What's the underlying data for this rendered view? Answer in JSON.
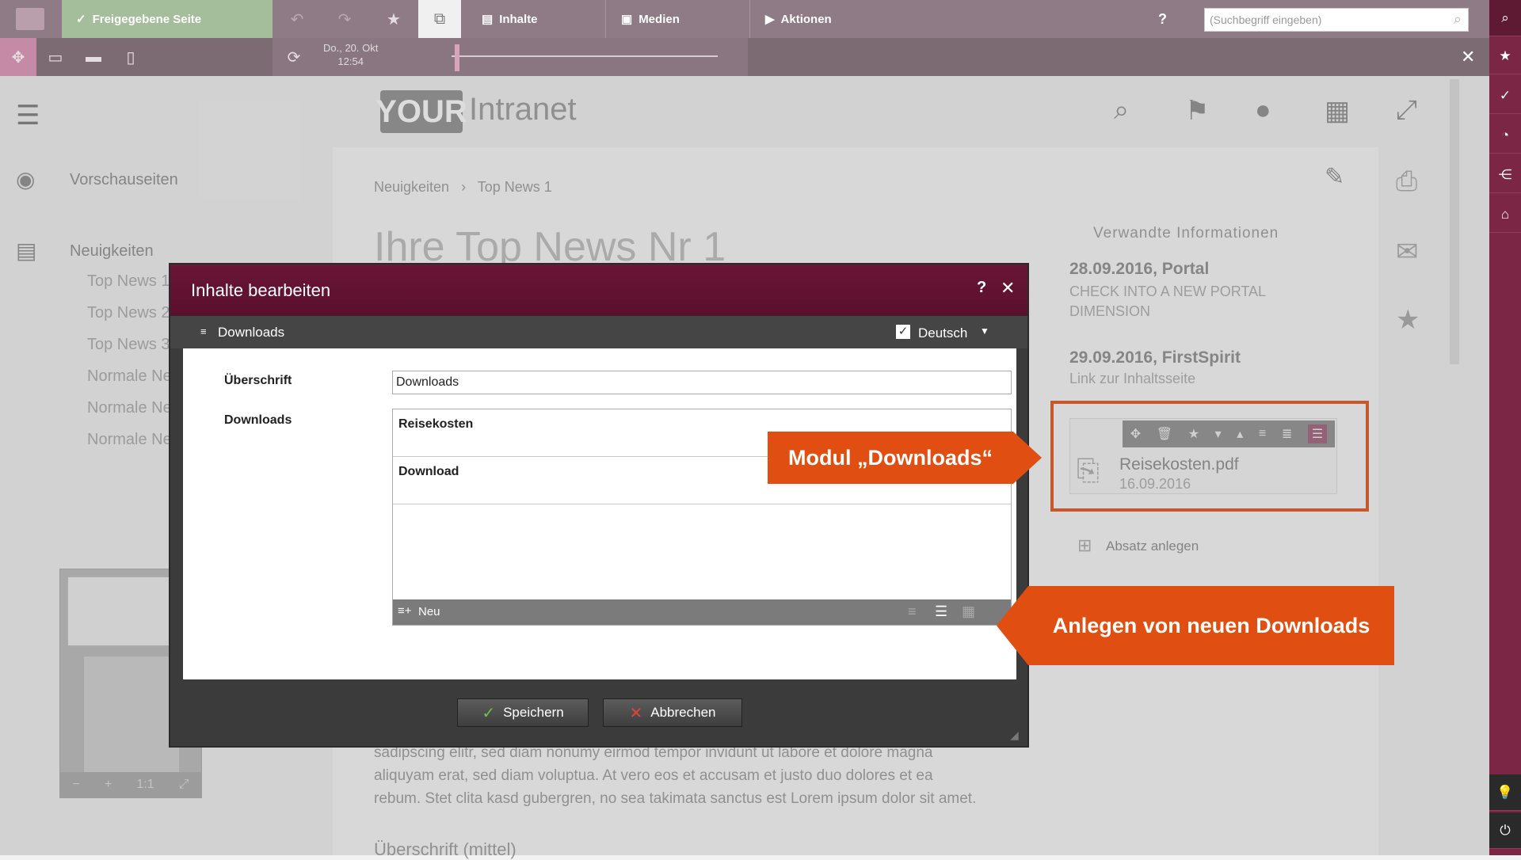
{
  "toolbar": {
    "release_label": "Freigegebene Seite",
    "menu_inhalte": "Inhalte",
    "menu_medien": "Medien",
    "menu_aktionen": "Aktionen",
    "help": "?",
    "search_placeholder": "(Suchbegriff eingeben)",
    "date_line1": "Do., 20. Okt",
    "date_line2": "12:54",
    "close": "✕"
  },
  "site": {
    "logo_box": "YOUR",
    "logo_text": "Intranet"
  },
  "leftnav": {
    "preview": "Vorschauseiten",
    "news": "Neuigkeiten",
    "items": [
      "Top News 1",
      "Top News 2",
      "Top News 3",
      "Normale News",
      "Normale News",
      "Normale News"
    ]
  },
  "content": {
    "breadcrumb_1": "Neuigkeiten",
    "breadcrumb_sep": "›",
    "breadcrumb_2": "Top News 1",
    "title": "Ihre Top News Nr 1",
    "body_line1": "sadipscing elitr, sed diam nonumy eirmod tempor invidunt ut labore et dolore magna",
    "body_line2": "aliquyam erat, sed diam voluptua. At vero eos et accusam et justo duo dolores et ea",
    "body_line3": "rebum. Stet clita kasd gubergren, no sea takimata sanctus est Lorem ipsum dolor sit amet.",
    "subheading": "Überschrift (mittel)"
  },
  "related": {
    "heading": "Verwandte Informationen",
    "item1_date": "28.09.2016, Portal",
    "item1_text": "CHECK INTO A NEW PORTAL DIMENSION",
    "item2_date": "29.09.2016, FirstSpirit",
    "item2_text": "Link zur Inhaltsseite",
    "file_name": "Reisekosten.pdf",
    "file_date": "16.09.2016",
    "add_section": "Absatz anlegen"
  },
  "dialog": {
    "title": "Inhalte bearbeiten",
    "help": "?",
    "close": "✕",
    "section": "Downloads",
    "language": "Deutsch",
    "label_heading": "Überschrift",
    "label_downloads": "Downloads",
    "heading_value": "Downloads",
    "entries": [
      "Reisekosten",
      "Download"
    ],
    "new_label": "Neu",
    "save": "Speichern",
    "cancel": "Abbrechen"
  },
  "callouts": {
    "module": "Modul „Downloads“",
    "new_downloads": "Anlegen von neuen Downloads"
  },
  "minimap": {
    "zoom": "1:1",
    "minus": "−",
    "plus": "+"
  },
  "colors": {
    "brand": "#6a1636",
    "accent": "#e04e12",
    "rail": "#7a2644"
  }
}
